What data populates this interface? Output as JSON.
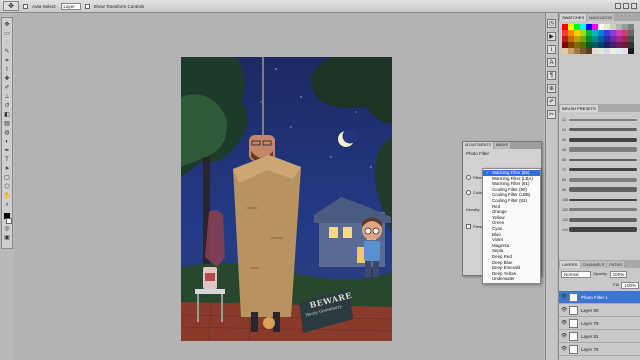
{
  "options_bar": {
    "tool_icon": "move-tool-icon",
    "auto_select_label": "Auto-Select:",
    "auto_select_value": "Layer",
    "show_transform_label": "Show Transform Controls"
  },
  "right_panel": {
    "swatches_tabs": [
      "SWATCHES",
      "NAVIGATOR"
    ],
    "swatch_colors": [
      "#ff0000",
      "#ffff00",
      "#00ff00",
      "#00ffff",
      "#0000ff",
      "#ff00ff",
      "#ffffff",
      "#e6e6e6",
      "#cccccc",
      "#b3b3b3",
      "#999999",
      "#808080",
      "#ff3b3b",
      "#ff8a00",
      "#ffd000",
      "#9ae000",
      "#00b84f",
      "#00b8b8",
      "#0083d6",
      "#3c3cd6",
      "#8a3cd6",
      "#d63cb8",
      "#d63c6a",
      "#666666",
      "#c01a1a",
      "#c06a00",
      "#c0a000",
      "#6fa800",
      "#008a3a",
      "#008a8a",
      "#005ea0",
      "#2a2aa0",
      "#6a2aa0",
      "#a02a8a",
      "#a02a4f",
      "#4d4d4d",
      "#800000",
      "#804000",
      "#806a00",
      "#4a7000",
      "#005c26",
      "#005c5c",
      "#003f6b",
      "#1c1c6b",
      "#461c6b",
      "#6b1c5c",
      "#6b1c34",
      "#333333",
      "#e8c9a0",
      "#c8a070",
      "#a07848",
      "#785830",
      "#584020",
      "#f0d8d8",
      "#d8f0d8",
      "#d8d8f0",
      "#f0f0d8",
      "#d8f0f0",
      "#f0d8f0",
      "#1a1a1a"
    ],
    "brush_tab": "BRUSH PRESETS",
    "brush_labels": [
      "12",
      "24",
      "36",
      "48",
      "60",
      "72",
      "84",
      "96",
      "108",
      "120",
      "132",
      "144"
    ],
    "layers_tabs": [
      "LAYERS",
      "CHANNELS",
      "PATHS"
    ],
    "blend_mode": "Normal",
    "opacity_label": "Opacity:",
    "opacity_value": "100%",
    "fill_label": "Fill:",
    "fill_value": "100%",
    "layers": [
      "Photo Filter 1",
      "Layer 80",
      "Layer 79",
      "Layer 81",
      "Layer 78"
    ]
  },
  "adjustments": {
    "tabs": [
      "ADJUSTMENTS",
      "MASKS"
    ],
    "title": "Photo Filter",
    "filter_label": "Filter:",
    "color_label": "Color:",
    "density_label": "Density:",
    "preserve_label": "Preserve Luminosity"
  },
  "filter_menu": {
    "selected": "Warming Filter (85)",
    "items": [
      "Warming Filter (85)",
      "Warming Filter (LBA)",
      "Warming Filter (81)",
      "Cooling Filter (80)",
      "Cooling Filter (LBB)",
      "Cooling Filter (82)",
      "Red",
      "Orange",
      "Yellow",
      "Green",
      "Cyan",
      "Blue",
      "Violet",
      "Magenta",
      "Sepia",
      "Deep Red",
      "Deep Blue",
      "Deep Emerald",
      "Deep Yellow",
      "Underwater"
    ]
  },
  "artwork": {
    "sign_line1": "BEWARE",
    "sign_line2": "Henry Gooseberry"
  }
}
